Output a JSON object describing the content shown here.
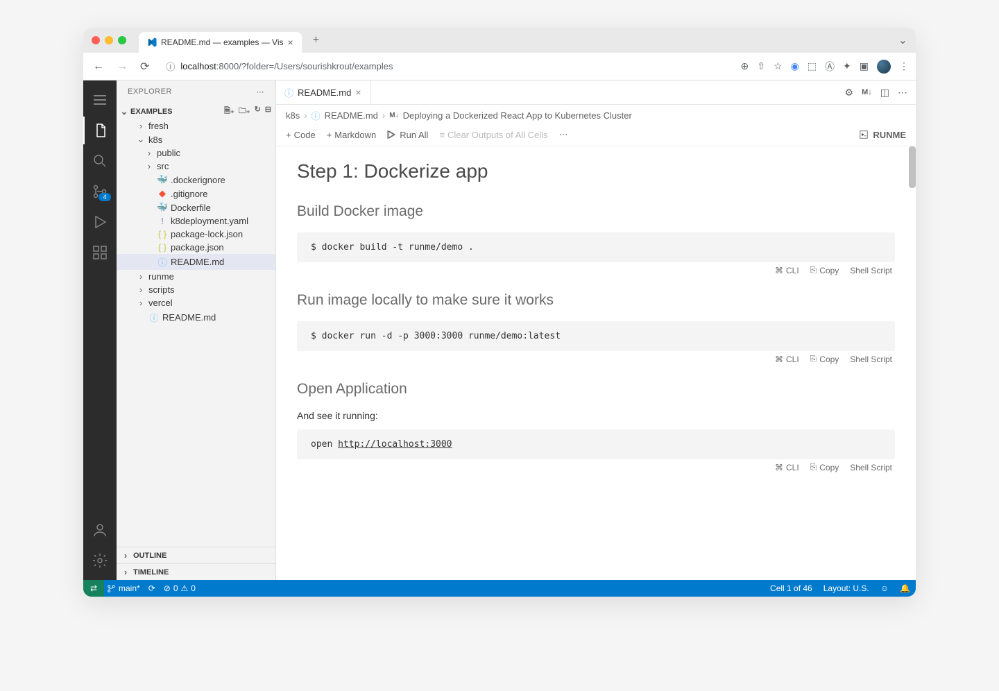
{
  "browser": {
    "tab_title": "README.md — examples — Vis",
    "url_host": "localhost",
    "url_port": ":8000",
    "url_path": "/?folder=/Users/sourishkrout/examples"
  },
  "activity_bar": {
    "scm_badge": "4"
  },
  "sidebar": {
    "title": "EXPLORER",
    "folder": "EXAMPLES",
    "tree": [
      {
        "label": "fresh",
        "type": "folder",
        "expanded": false,
        "depth": 2
      },
      {
        "label": "k8s",
        "type": "folder",
        "expanded": true,
        "depth": 2
      },
      {
        "label": "public",
        "type": "folder",
        "expanded": false,
        "depth": 3
      },
      {
        "label": "src",
        "type": "folder",
        "expanded": false,
        "depth": 3
      },
      {
        "label": ".dockerignore",
        "type": "file",
        "icon": "docker",
        "depth": 3
      },
      {
        "label": ".gitignore",
        "type": "file",
        "icon": "git",
        "depth": 3
      },
      {
        "label": "Dockerfile",
        "type": "file",
        "icon": "docker",
        "depth": 3
      },
      {
        "label": "k8deployment.yaml",
        "type": "file",
        "icon": "yaml",
        "depth": 3
      },
      {
        "label": "package-lock.json",
        "type": "file",
        "icon": "json",
        "depth": 3
      },
      {
        "label": "package.json",
        "type": "file",
        "icon": "json",
        "depth": 3
      },
      {
        "label": "README.md",
        "type": "file",
        "icon": "info",
        "depth": 3,
        "selected": true
      },
      {
        "label": "runme",
        "type": "folder",
        "expanded": false,
        "depth": 2
      },
      {
        "label": "scripts",
        "type": "folder",
        "expanded": false,
        "depth": 2
      },
      {
        "label": "vercel",
        "type": "folder",
        "expanded": false,
        "depth": 2
      },
      {
        "label": "README.md",
        "type": "file",
        "icon": "info",
        "depth": 2
      }
    ],
    "outline": "OUTLINE",
    "timeline": "TIMELINE"
  },
  "editor": {
    "tab_label": "README.md",
    "tab_actions": {
      "md": "M↓"
    },
    "breadcrumbs": {
      "parts": [
        "k8s",
        "README.md",
        "Deploying a Dockerized React App to Kubernetes Cluster"
      ],
      "md_badge": "M↓"
    },
    "toolbar": {
      "code": "Code",
      "markdown": "Markdown",
      "run_all": "Run All",
      "clear": "Clear Outputs of All Cells",
      "runme": "RUNME"
    }
  },
  "notebook": {
    "h1": "Step 1: Dockerize app",
    "sections": [
      {
        "heading": "Build Docker image",
        "code": "$ docker build -t runme/demo .",
        "footer": {
          "cli": "CLI",
          "copy": "Copy",
          "lang": "Shell Script"
        }
      },
      {
        "heading": "Run image locally to make sure it works",
        "code": "$ docker run -d -p 3000:3000 runme/demo:latest",
        "footer": {
          "cli": "CLI",
          "copy": "Copy",
          "lang": "Shell Script"
        }
      },
      {
        "heading": "Open Application",
        "paragraph": "And see it running:",
        "code_plain": "open ",
        "code_link": "http://localhost:3000",
        "footer": {
          "cli": "CLI",
          "copy": "Copy",
          "lang": "Shell Script"
        }
      }
    ]
  },
  "status": {
    "branch": "main*",
    "errors": "0",
    "warnings": "0",
    "cell": "Cell 1 of 46",
    "layout": "Layout: U.S."
  }
}
